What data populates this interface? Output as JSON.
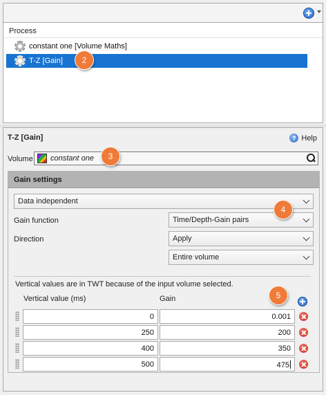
{
  "process": {
    "header": "Process",
    "items": [
      {
        "label": "constant one [Volume Maths]",
        "selected": false
      },
      {
        "label": "T-Z [Gain]",
        "selected": true
      }
    ]
  },
  "callouts": [
    "2",
    "3",
    "4",
    "5"
  ],
  "details": {
    "title": "T-Z [Gain]",
    "help_label": "Help",
    "help_icon": "?",
    "volume_label": "Volume",
    "volume_value": "constant one"
  },
  "gain": {
    "header": "Gain settings",
    "mode": "Data independent",
    "gain_function_label": "Gain function",
    "gain_function_value": "Time/Depth-Gain pairs",
    "direction_label": "Direction",
    "direction_value": "Apply",
    "extent_value": "Entire volume",
    "info_text": "Vertical values are in TWT because of the input volume selected.",
    "columns": [
      "Vertical value (ms)",
      "Gain"
    ],
    "rows": [
      {
        "vertical": "0",
        "gain": "0.001"
      },
      {
        "vertical": "250",
        "gain": "200"
      },
      {
        "vertical": "400",
        "gain": "350"
      },
      {
        "vertical": "500",
        "gain": "475"
      }
    ]
  },
  "colors": {
    "selection": "#1874d0",
    "callout": "#f07a38",
    "section_header": "#b3b3b3"
  }
}
